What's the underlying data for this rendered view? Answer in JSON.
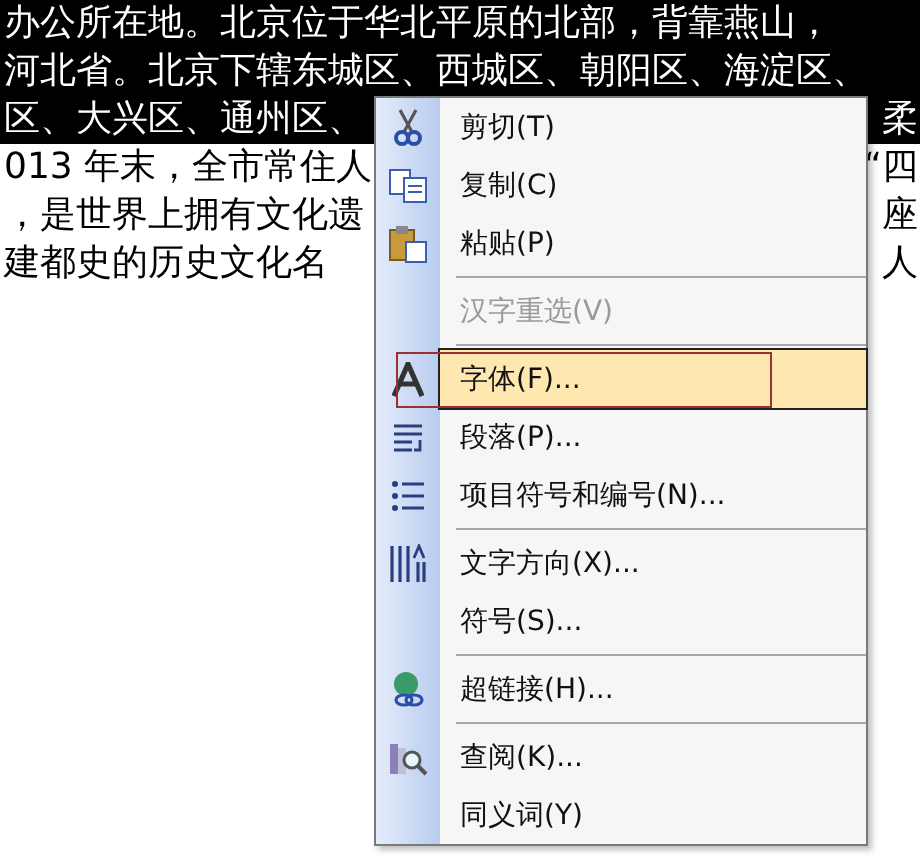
{
  "document": {
    "lines": [
      {
        "left": "办公所在地。北京位于华北平原的北部，背靠燕山，",
        "selected": true
      },
      {
        "left": "河北省。北京下辖东城区、西城区、朝阳区、海淀区、",
        "selected": true
      },
      {
        "left": "区、大兴区、通州区、",
        "right": "柔",
        "selected": true
      },
      {
        "left": "013 年末，全市常住人",
        "right": "“四",
        "selected": false
      },
      {
        "left": "，是世界上拥有文化遗",
        "right": "座",
        "selected": false
      },
      {
        "left": "建都史的历史文化名",
        "right": "人",
        "selected": false
      }
    ]
  },
  "context_menu": {
    "items": [
      {
        "kind": "item",
        "label": "剪切(T)",
        "disabled": false,
        "selected": false
      },
      {
        "kind": "item",
        "label": "复制(C)",
        "disabled": false,
        "selected": false
      },
      {
        "kind": "item",
        "label": "粘贴(P)",
        "disabled": false,
        "selected": false
      },
      {
        "kind": "separator"
      },
      {
        "kind": "item",
        "label": "汉字重选(V)",
        "disabled": true,
        "selected": false
      },
      {
        "kind": "separator"
      },
      {
        "kind": "item",
        "label": "字体(F)...",
        "disabled": false,
        "selected": true
      },
      {
        "kind": "item",
        "label": "段落(P)...",
        "disabled": false,
        "selected": false
      },
      {
        "kind": "item",
        "label": "项目符号和编号(N)...",
        "disabled": false,
        "selected": false
      },
      {
        "kind": "separator"
      },
      {
        "kind": "item",
        "label": "文字方向(X)...",
        "disabled": false,
        "selected": false
      },
      {
        "kind": "item",
        "label": "符号(S)...",
        "disabled": false,
        "selected": false
      },
      {
        "kind": "separator"
      },
      {
        "kind": "item",
        "label": "超链接(H)...",
        "disabled": false,
        "selected": false
      },
      {
        "kind": "separator"
      },
      {
        "kind": "item",
        "label": "查阅(K)...",
        "disabled": false,
        "selected": false
      },
      {
        "kind": "item",
        "label": "同义词(Y)",
        "disabled": false,
        "selected": false
      }
    ]
  }
}
